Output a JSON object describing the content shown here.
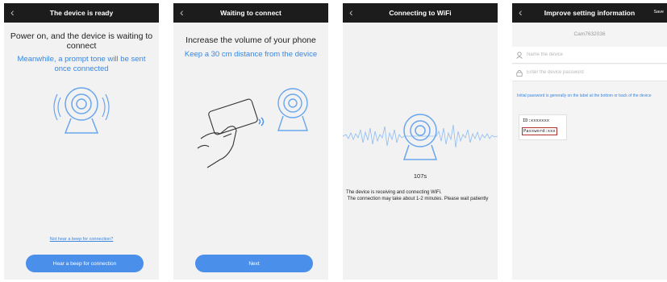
{
  "screen1": {
    "title": "The device is ready",
    "heading": "Power on, and the device is waiting to connect",
    "subheading": "Meanwhile, a prompt tone will be sent once connected",
    "link": "Not hear a beep for connection?",
    "button": "Hear a beep for connection"
  },
  "screen2": {
    "title": "Waiting to connect",
    "heading": "Increase the volume of your phone",
    "subheading": "Keep a 30 cm distance from the device",
    "button": "Next"
  },
  "screen3": {
    "title": "Connecting to WiFi",
    "countdown": "107s",
    "line1": "The device is receiving and connecting WiFi.",
    "line2": " The connection may take about 1-2 minutes. Please wait patiently"
  },
  "screen4": {
    "title": "Improve setting information",
    "save": "Save",
    "device_id": "Cam7632036",
    "name_placeholder": "Name the device",
    "password_placeholder": "Enter the device password",
    "hint": "Initial password is generally on the label at the bottom or back of the device",
    "label_id": "ID:xxxxxxx",
    "label_password": "Password:xxx"
  },
  "icons": {
    "back": "chevron-left-icon",
    "camera": "camera-icon",
    "phone": "phone-in-hand-icon",
    "sound": "sound-wave-icon",
    "user": "user-icon",
    "lock": "lock-icon"
  },
  "colors": {
    "accent": "#4a8fea",
    "link": "#3a86e0",
    "topbar": "#1c1c1c",
    "label_border": "#b03030"
  }
}
